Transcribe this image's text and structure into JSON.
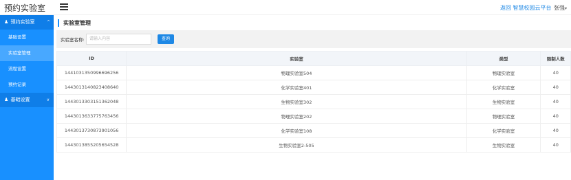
{
  "header": {
    "brand": "预约实验室",
    "back_link": "返回 智慧校园云平台",
    "user_name": "张强",
    "user_caret": "▾"
  },
  "sidebar": {
    "group1": {
      "label": "预约实验室",
      "icon": "user-icon",
      "arrow": "^"
    },
    "items": [
      {
        "label": "基础设置"
      },
      {
        "label": "实验室管理"
      },
      {
        "label": "流程设置"
      },
      {
        "label": "预约记录"
      }
    ],
    "group2": {
      "label": "基础设置",
      "icon": "user-icon",
      "arrow": "v"
    }
  },
  "main": {
    "title": "实验室管理",
    "search": {
      "label": "实验室名称:",
      "placeholder": "请输入内容",
      "button": "查询"
    },
    "table": {
      "headers": [
        "ID",
        "实验室",
        "类型",
        "限制人数"
      ],
      "rows": [
        [
          "1441031350996696256",
          "物理实验室504",
          "物理实验室",
          "40"
        ],
        [
          "1443013140823408640",
          "化学实验室401",
          "化学实验室",
          "40"
        ],
        [
          "1443013303151362048",
          "生物实验室302",
          "生物实验室",
          "40"
        ],
        [
          "1443013633775763456",
          "物理实验室202",
          "物理实验室",
          "40"
        ],
        [
          "1443013730873901056",
          "化学实验室108",
          "化学实验室",
          "40"
        ],
        [
          "1443013855205654528",
          "生物实验室2-505",
          "生物实验室",
          "40"
        ]
      ]
    }
  },
  "colors": {
    "sidebar": "#1890ff",
    "sidebar_group": "#0f7ee8",
    "sidebar_active": "#48a8ff",
    "accent": "#1e88e5"
  }
}
